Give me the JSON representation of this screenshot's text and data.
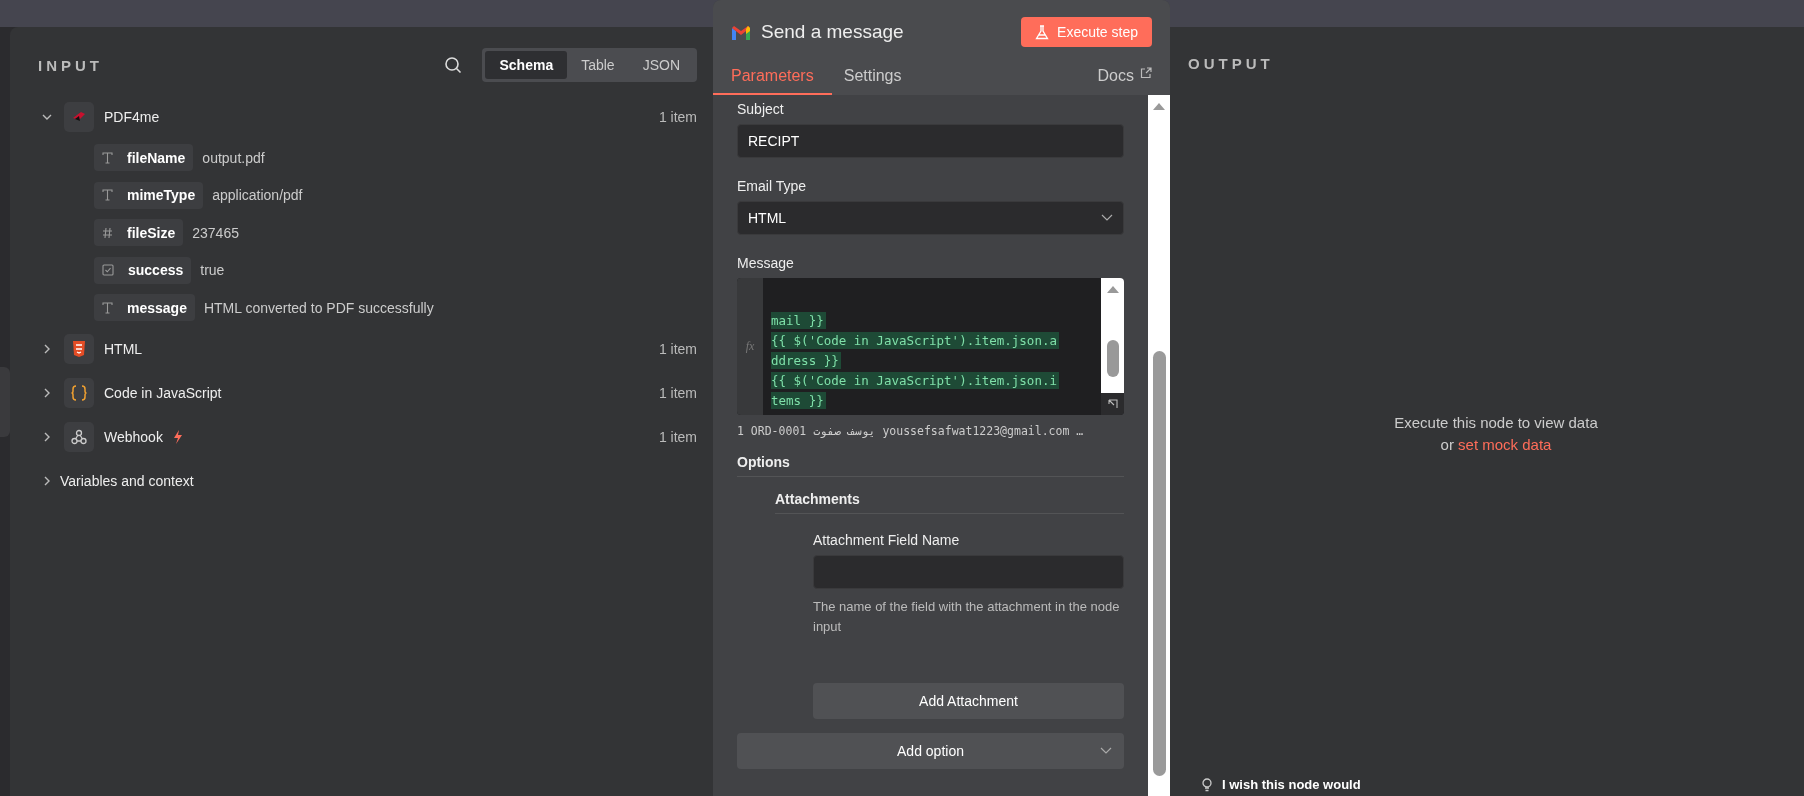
{
  "input_panel": {
    "title": "INPUT",
    "view_tabs": [
      {
        "label": "Schema",
        "selected": true
      },
      {
        "label": "Table",
        "selected": false
      },
      {
        "label": "JSON",
        "selected": false
      }
    ],
    "nodes": [
      {
        "kind": "pdf",
        "name": "PDF4me",
        "count": "1 item",
        "expanded": true,
        "trigger": false,
        "fields": [
          {
            "kind": "string",
            "key": "fileName",
            "value": "output.pdf"
          },
          {
            "kind": "string",
            "key": "mimeType",
            "value": "application/pdf"
          },
          {
            "kind": "number",
            "key": "fileSize",
            "value": "237465"
          },
          {
            "kind": "boolean",
            "key": "success",
            "value": "true"
          },
          {
            "kind": "string",
            "key": "message",
            "value": "HTML converted to PDF successfully"
          }
        ]
      },
      {
        "kind": "html",
        "name": "HTML",
        "count": "1 item",
        "expanded": false,
        "trigger": false
      },
      {
        "kind": "code",
        "name": "Code in JavaScript",
        "count": "1 item",
        "expanded": false,
        "trigger": false
      },
      {
        "kind": "webhook",
        "name": "Webhook",
        "count": "1 item",
        "expanded": false,
        "trigger": true
      }
    ],
    "variables": {
      "label": "Variables and context",
      "expanded": false
    }
  },
  "node_panel": {
    "title": "Send a message",
    "execute_button": "Execute step",
    "tabs": [
      {
        "label": "Parameters",
        "selected": true
      },
      {
        "label": "Settings",
        "selected": false
      }
    ],
    "docs_link": "Docs",
    "subject": {
      "label": "Subject",
      "value": "RECIPT"
    },
    "email_type": {
      "label": "Email Type",
      "value": "HTML"
    },
    "message": {
      "label": "Message",
      "editor_prefix": "fx",
      "code_lines": [
        "mail }}",
        "{{ $('Code in JavaScript').item.json.a",
        "ddress }}",
        "{{ $('Code in JavaScript').item.json.i",
        "tems }}"
      ],
      "preview": "1 ORD-0001 يوسف صفوت youssefsafwat1223@gmail.com …"
    },
    "options": {
      "label": "Options",
      "attachments": {
        "label": "Attachments",
        "field_label": "Attachment Field Name",
        "hint": "The name of the field with the attachment in the node input",
        "add_button": "Add Attachment"
      },
      "add_option": "Add option"
    }
  },
  "output_panel": {
    "title": "OUTPUT",
    "empty_message": "Execute this node to view data",
    "or": "or",
    "mock_link": "set mock data"
  },
  "feedback": {
    "text": "I wish this node would"
  }
}
